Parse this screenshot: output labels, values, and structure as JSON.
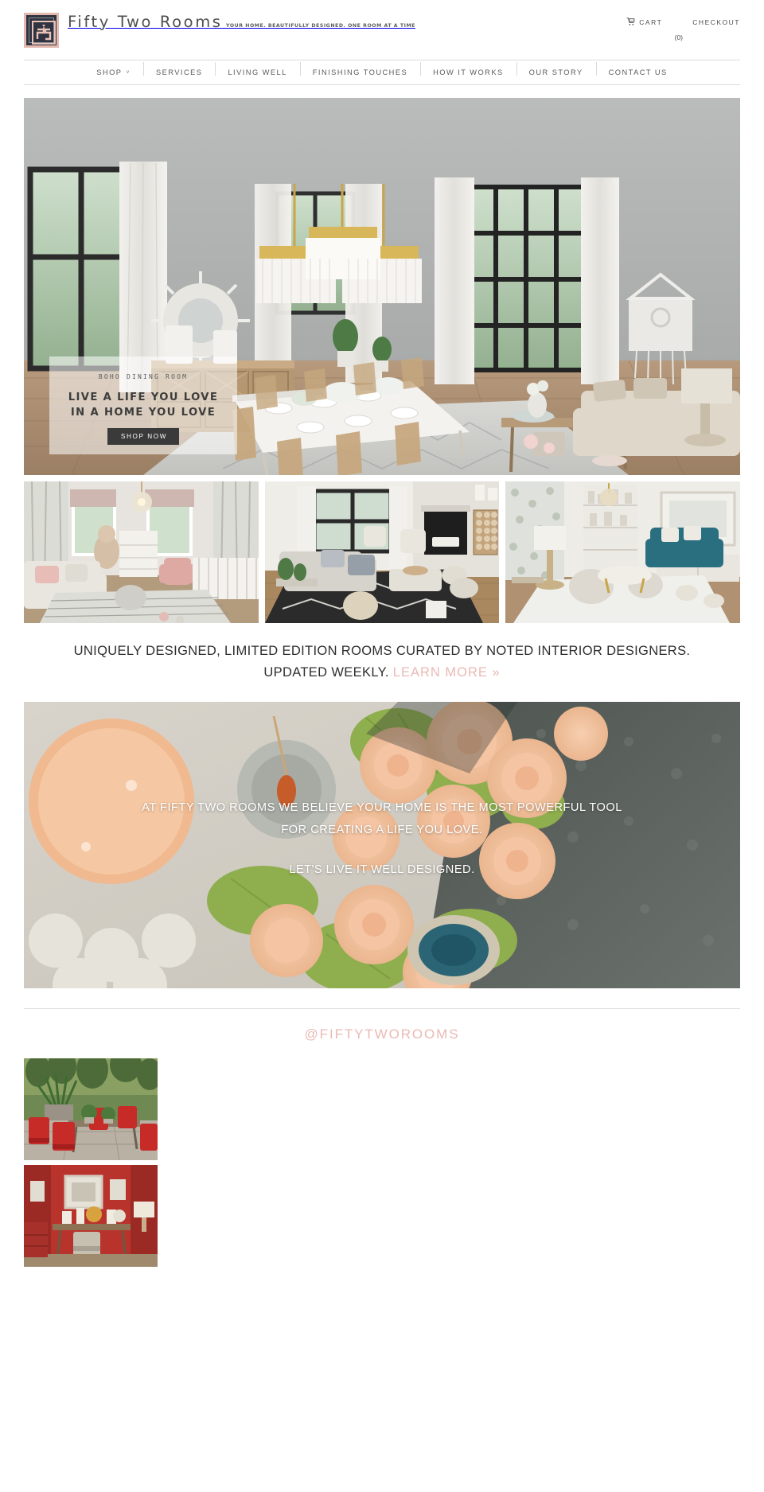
{
  "header": {
    "brand_name": "Fifty Two Rooms",
    "brand_tagline": "YOUR HOME. BEAUTIFULLY DESIGNED. ONE ROOM AT A TIME",
    "cart_label": "CART",
    "cart_count": "(0)",
    "checkout_label": "CHECKOUT",
    "cart_icon": "shopping-cart-icon"
  },
  "nav": {
    "items": [
      {
        "label": "SHOP",
        "caret": "˅",
        "has_caret": true
      },
      {
        "label": "SERVICES",
        "has_caret": false
      },
      {
        "label": "LIVING WELL",
        "has_caret": false
      },
      {
        "label": "FINISHING TOUCHES",
        "has_caret": false
      },
      {
        "label": "HOW IT WORKS",
        "has_caret": false
      },
      {
        "label": "OUR STORY",
        "has_caret": false
      },
      {
        "label": "CONTACT US",
        "has_caret": false
      }
    ]
  },
  "hero": {
    "eyebrow": "BOHO  DINING  ROOM",
    "title_line1": "LIVE A LIFE YOU LOVE",
    "title_line2": "IN A HOME YOU LOVE",
    "button_label": "SHOP NOW",
    "image_alt": "boho dining room with chandeliers and long white table"
  },
  "trio": {
    "items": [
      {
        "alt": "nursery with pink accents and crib"
      },
      {
        "alt": "living room with fireplace and black and white rug"
      },
      {
        "alt": "living room with teal sofa and wallpaper"
      }
    ]
  },
  "tagline": {
    "line1": "UNIQUELY DESIGNED, LIMITED EDITION ROOMS CURATED BY NOTED INTERIOR",
    "line2": "DESIGNERS.",
    "line3": "UPDATED WEEKLY.",
    "link": "LEARN MORE »"
  },
  "mission": {
    "line1": "AT FIFTY TWO ROOMS WE BELIEVE YOUR HOME IS THE MOST POWERFUL TOOL",
    "line2": "FOR CREATING A LIFE YOU LOVE.",
    "line3": "LET'S LIVE IT WELL DESIGNED.",
    "image_alt": "peach roses, candle and marble tabletop flatlay"
  },
  "instagram": {
    "handle": "@FIFTYTWOROOMS",
    "posts": [
      {
        "alt": "outdoor patio with red chairs and greenery"
      },
      {
        "alt": "red dining room with console table"
      }
    ]
  },
  "colors": {
    "accent_pink": "#eab9b4",
    "logo_frame": "#e3b8ae",
    "logo_bg": "#2f3440",
    "text_dark": "#2e2e2e",
    "button_dark": "#3a3a3a"
  }
}
